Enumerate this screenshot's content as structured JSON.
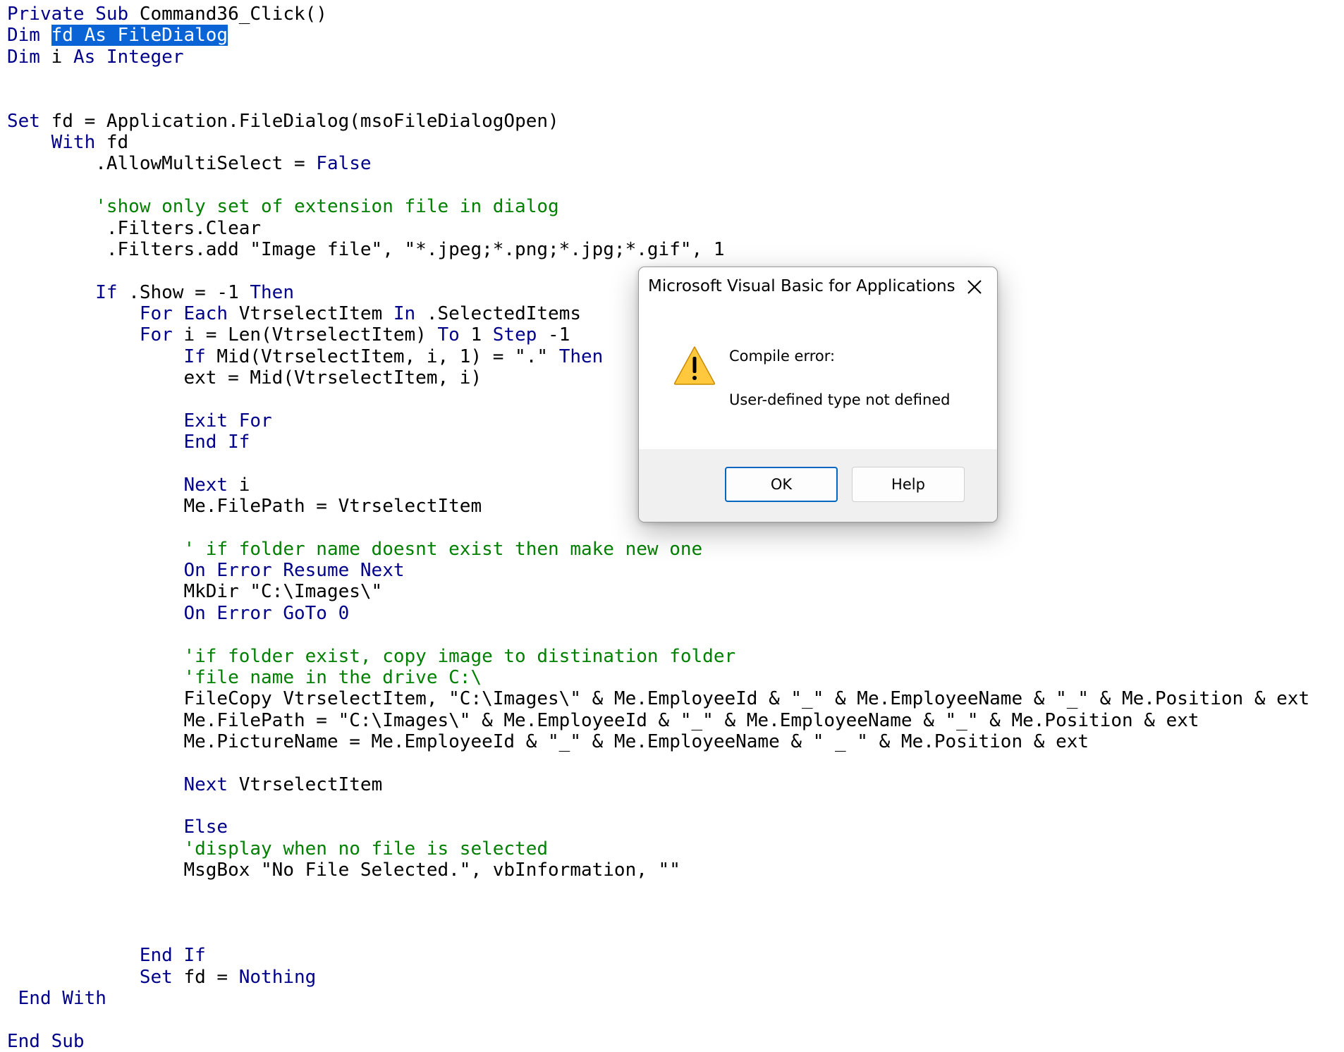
{
  "code": {
    "lines": [
      {
        "segments": [
          {
            "text": "Private Sub ",
            "cls": "kw"
          },
          {
            "text": "Command36_Click()",
            "cls": ""
          }
        ]
      },
      {
        "segments": [
          {
            "text": "Dim ",
            "cls": "kw"
          },
          {
            "text": "fd As FileDialog",
            "cls": "sel"
          }
        ]
      },
      {
        "segments": [
          {
            "text": "Dim ",
            "cls": "kw"
          },
          {
            "text": "i ",
            "cls": ""
          },
          {
            "text": "As Integer",
            "cls": "kw"
          }
        ]
      },
      {
        "segments": []
      },
      {
        "segments": []
      },
      {
        "segments": [
          {
            "text": "Set ",
            "cls": "kw"
          },
          {
            "text": "fd = Application.FileDialog(msoFileDialogOpen)",
            "cls": ""
          }
        ]
      },
      {
        "segments": [
          {
            "text": "    With ",
            "cls": "kw"
          },
          {
            "text": "fd",
            "cls": ""
          }
        ]
      },
      {
        "segments": [
          {
            "text": "        .AllowMultiSelect = ",
            "cls": ""
          },
          {
            "text": "False",
            "cls": "kw"
          }
        ]
      },
      {
        "segments": []
      },
      {
        "segments": [
          {
            "text": "        'show only set of extension file in dialog",
            "cls": "cm"
          }
        ]
      },
      {
        "segments": [
          {
            "text": "         .Filters.Clear",
            "cls": ""
          }
        ]
      },
      {
        "segments": [
          {
            "text": "         .Filters.add \"Image file\", \"*.jpeg;*.png;*.jpg;*.gif\", 1",
            "cls": ""
          }
        ]
      },
      {
        "segments": []
      },
      {
        "segments": [
          {
            "text": "        If ",
            "cls": "kw"
          },
          {
            "text": ".Show = -1 ",
            "cls": ""
          },
          {
            "text": "Then",
            "cls": "kw"
          }
        ]
      },
      {
        "segments": [
          {
            "text": "            For Each ",
            "cls": "kw"
          },
          {
            "text": "VtrselectItem ",
            "cls": ""
          },
          {
            "text": "In ",
            "cls": "kw"
          },
          {
            "text": ".SelectedItems",
            "cls": ""
          }
        ]
      },
      {
        "segments": [
          {
            "text": "            For ",
            "cls": "kw"
          },
          {
            "text": "i = Len(VtrselectItem) ",
            "cls": ""
          },
          {
            "text": "To ",
            "cls": "kw"
          },
          {
            "text": "1 ",
            "cls": ""
          },
          {
            "text": "Step ",
            "cls": "kw"
          },
          {
            "text": "-1",
            "cls": ""
          }
        ]
      },
      {
        "segments": [
          {
            "text": "                If ",
            "cls": "kw"
          },
          {
            "text": "Mid(VtrselectItem, i, 1) = \".\" ",
            "cls": ""
          },
          {
            "text": "Then",
            "cls": "kw"
          }
        ]
      },
      {
        "segments": [
          {
            "text": "                ext = Mid(VtrselectItem, i)",
            "cls": ""
          }
        ]
      },
      {
        "segments": []
      },
      {
        "segments": [
          {
            "text": "                Exit For",
            "cls": "kw"
          }
        ]
      },
      {
        "segments": [
          {
            "text": "                End If",
            "cls": "kw"
          }
        ]
      },
      {
        "segments": []
      },
      {
        "segments": [
          {
            "text": "                Next ",
            "cls": "kw"
          },
          {
            "text": "i",
            "cls": ""
          }
        ]
      },
      {
        "segments": [
          {
            "text": "                Me.FilePath = VtrselectItem",
            "cls": ""
          }
        ]
      },
      {
        "segments": []
      },
      {
        "segments": [
          {
            "text": "                ' if folder name doesnt exist then make new one",
            "cls": "cm"
          }
        ]
      },
      {
        "segments": [
          {
            "text": "                On Error Resume Next",
            "cls": "kw"
          }
        ]
      },
      {
        "segments": [
          {
            "text": "                MkDir \"C:\\Images\\\"",
            "cls": ""
          }
        ]
      },
      {
        "segments": [
          {
            "text": "                On Error GoTo 0",
            "cls": "kw"
          }
        ]
      },
      {
        "segments": []
      },
      {
        "segments": [
          {
            "text": "                'if folder exist, copy image to distination folder",
            "cls": "cm"
          }
        ]
      },
      {
        "segments": [
          {
            "text": "                'file name in the drive C:\\",
            "cls": "cm"
          }
        ]
      },
      {
        "segments": [
          {
            "text": "                FileCopy VtrselectItem, \"C:\\Images\\\" & Me.EmployeeId & \"_\" & Me.EmployeeName & \"_\" & Me.Position & ext",
            "cls": ""
          }
        ]
      },
      {
        "segments": [
          {
            "text": "                Me.FilePath = \"C:\\Images\\\" & Me.EmployeeId & \"_\" & Me.EmployeeName & \"_\" & Me.Position & ext",
            "cls": ""
          }
        ]
      },
      {
        "segments": [
          {
            "text": "                Me.PictureName = Me.EmployeeId & \"_\" & Me.EmployeeName & \" _ \" & Me.Position & ext",
            "cls": ""
          }
        ]
      },
      {
        "segments": []
      },
      {
        "segments": [
          {
            "text": "                Next ",
            "cls": "kw"
          },
          {
            "text": "VtrselectItem",
            "cls": ""
          }
        ]
      },
      {
        "segments": []
      },
      {
        "segments": [
          {
            "text": "                Else",
            "cls": "kw"
          }
        ]
      },
      {
        "segments": [
          {
            "text": "                'display when no file is selected",
            "cls": "cm"
          }
        ]
      },
      {
        "segments": [
          {
            "text": "                MsgBox \"No File Selected.\", vbInformation, \"\"",
            "cls": ""
          }
        ]
      },
      {
        "segments": []
      },
      {
        "segments": []
      },
      {
        "segments": []
      },
      {
        "segments": [
          {
            "text": "            End If",
            "cls": "kw"
          }
        ]
      },
      {
        "segments": [
          {
            "text": "            Set ",
            "cls": "kw"
          },
          {
            "text": "fd = ",
            "cls": ""
          },
          {
            "text": "Nothing",
            "cls": "kw"
          }
        ]
      },
      {
        "segments": [
          {
            "text": " End With",
            "cls": "kw"
          }
        ]
      },
      {
        "segments": []
      },
      {
        "segments": [
          {
            "text": "End Sub",
            "cls": "kw"
          }
        ]
      }
    ]
  },
  "dialog": {
    "title": "Microsoft Visual Basic for Applications",
    "close_icon": "close-icon",
    "warning_icon": "warning-icon",
    "heading": "Compile error:",
    "message": "User-defined type not defined",
    "ok_label": "OK",
    "help_label": "Help"
  },
  "colors": {
    "keyword": "#00008b",
    "comment": "#008000",
    "selection": "#0a64d6",
    "default_button_border": "#0067c0",
    "warning_fill": "#ffc83d"
  }
}
